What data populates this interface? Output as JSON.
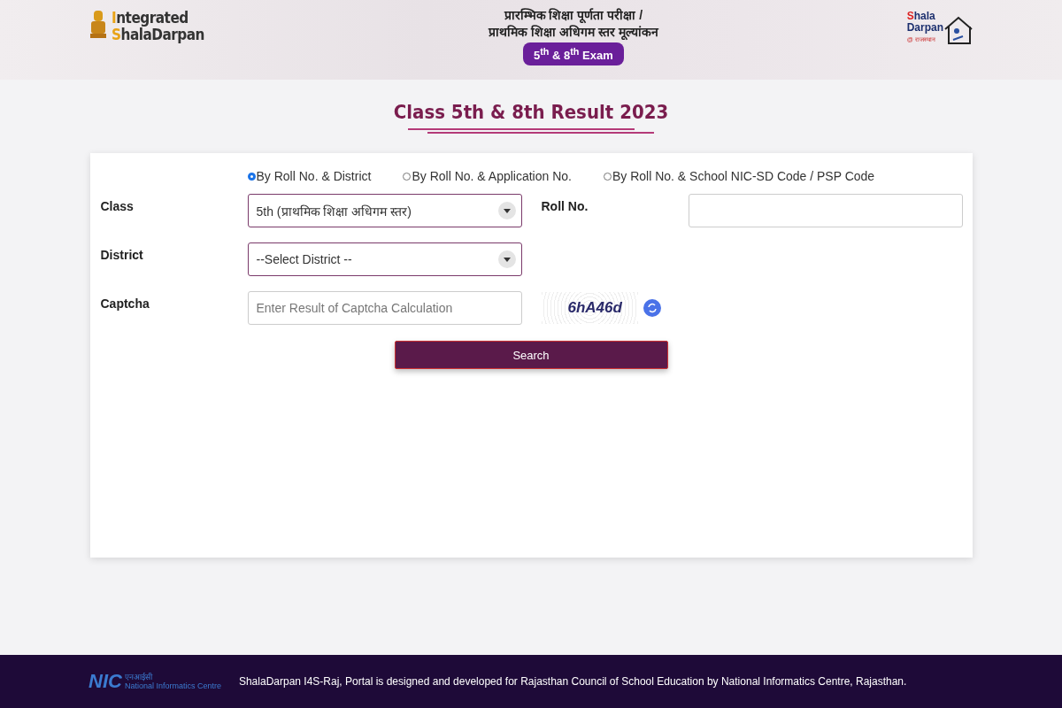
{
  "header": {
    "logo_left": {
      "line1": "Integrated",
      "line2": "ShalaDarpan"
    },
    "heading_lines": [
      "प्रारम्भिक शिक्षा पूर्णता परीक्षा /",
      "प्राथमिक शिक्षा अधिगम स्तर मूल्यांकन"
    ],
    "exam_badge": "5$^{th}$ & 8$^{th}$ Exam",
    "logo_right": {
      "line1": "Shala",
      "line2": "Darpan",
      "tag": "@ राजस्थान"
    }
  },
  "page_title": "Class 5th & 8th Result 2023",
  "search_modes": [
    {
      "label": "By Roll No. & District",
      "selected": true
    },
    {
      "label": "By Roll No. & Application No.",
      "selected": false
    },
    {
      "label": "By Roll No. & School NIC-SD Code / PSP Code",
      "selected": false
    }
  ],
  "form": {
    "class_label": "Class",
    "class_value": "5th (प्राथमिक शिक्षा अधिगम स्तर)",
    "roll_label": "Roll No.",
    "district_label": "District",
    "district_value": "--Select District --",
    "captcha_label": "Captcha",
    "captcha_placeholder": "Enter Result of Captcha Calculation",
    "captcha_text": "6hA46d",
    "search_button": "Search"
  },
  "footer": {
    "logo": {
      "short": "NIC",
      "hindi": "एनआईसी",
      "name": "National Informatics Centre"
    },
    "text": "ShalaDarpan I4S-Raj, Portal is designed and developed for Rajasthan Council of School Education by National Informatics Centre, Rajasthan."
  }
}
